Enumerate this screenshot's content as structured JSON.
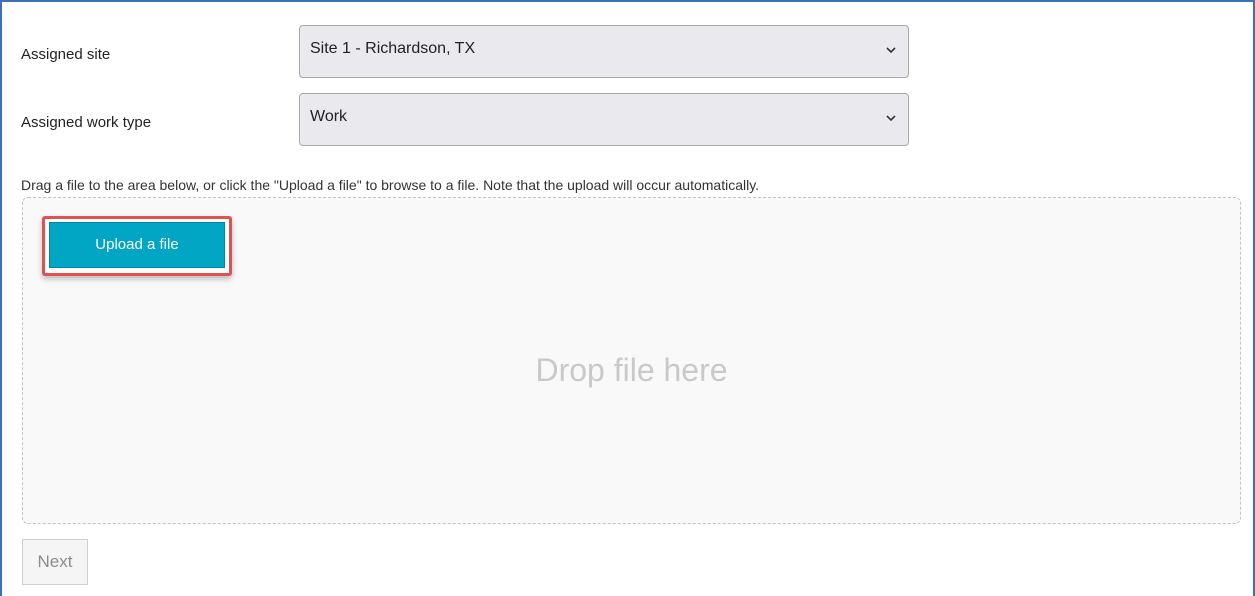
{
  "form": {
    "site_label": "Assigned site",
    "site_value": "Site 1 - Richardson, TX",
    "work_type_label": "Assigned work type",
    "work_type_value": "Work"
  },
  "upload": {
    "instructions": "Drag a file to the area below, or click the \"Upload a file\" to browse to a file. Note that the upload will occur automatically.",
    "button_label": "Upload a file",
    "drop_text": "Drop file here"
  },
  "footer": {
    "next_label": "Next"
  },
  "icons": {
    "select_chevron": "chevron-down-icon"
  },
  "colors": {
    "frame_border": "#3f6fb5",
    "upload_button": "#00a6c4",
    "highlight": "#e05252",
    "drop_text": "#c9c9c9"
  }
}
